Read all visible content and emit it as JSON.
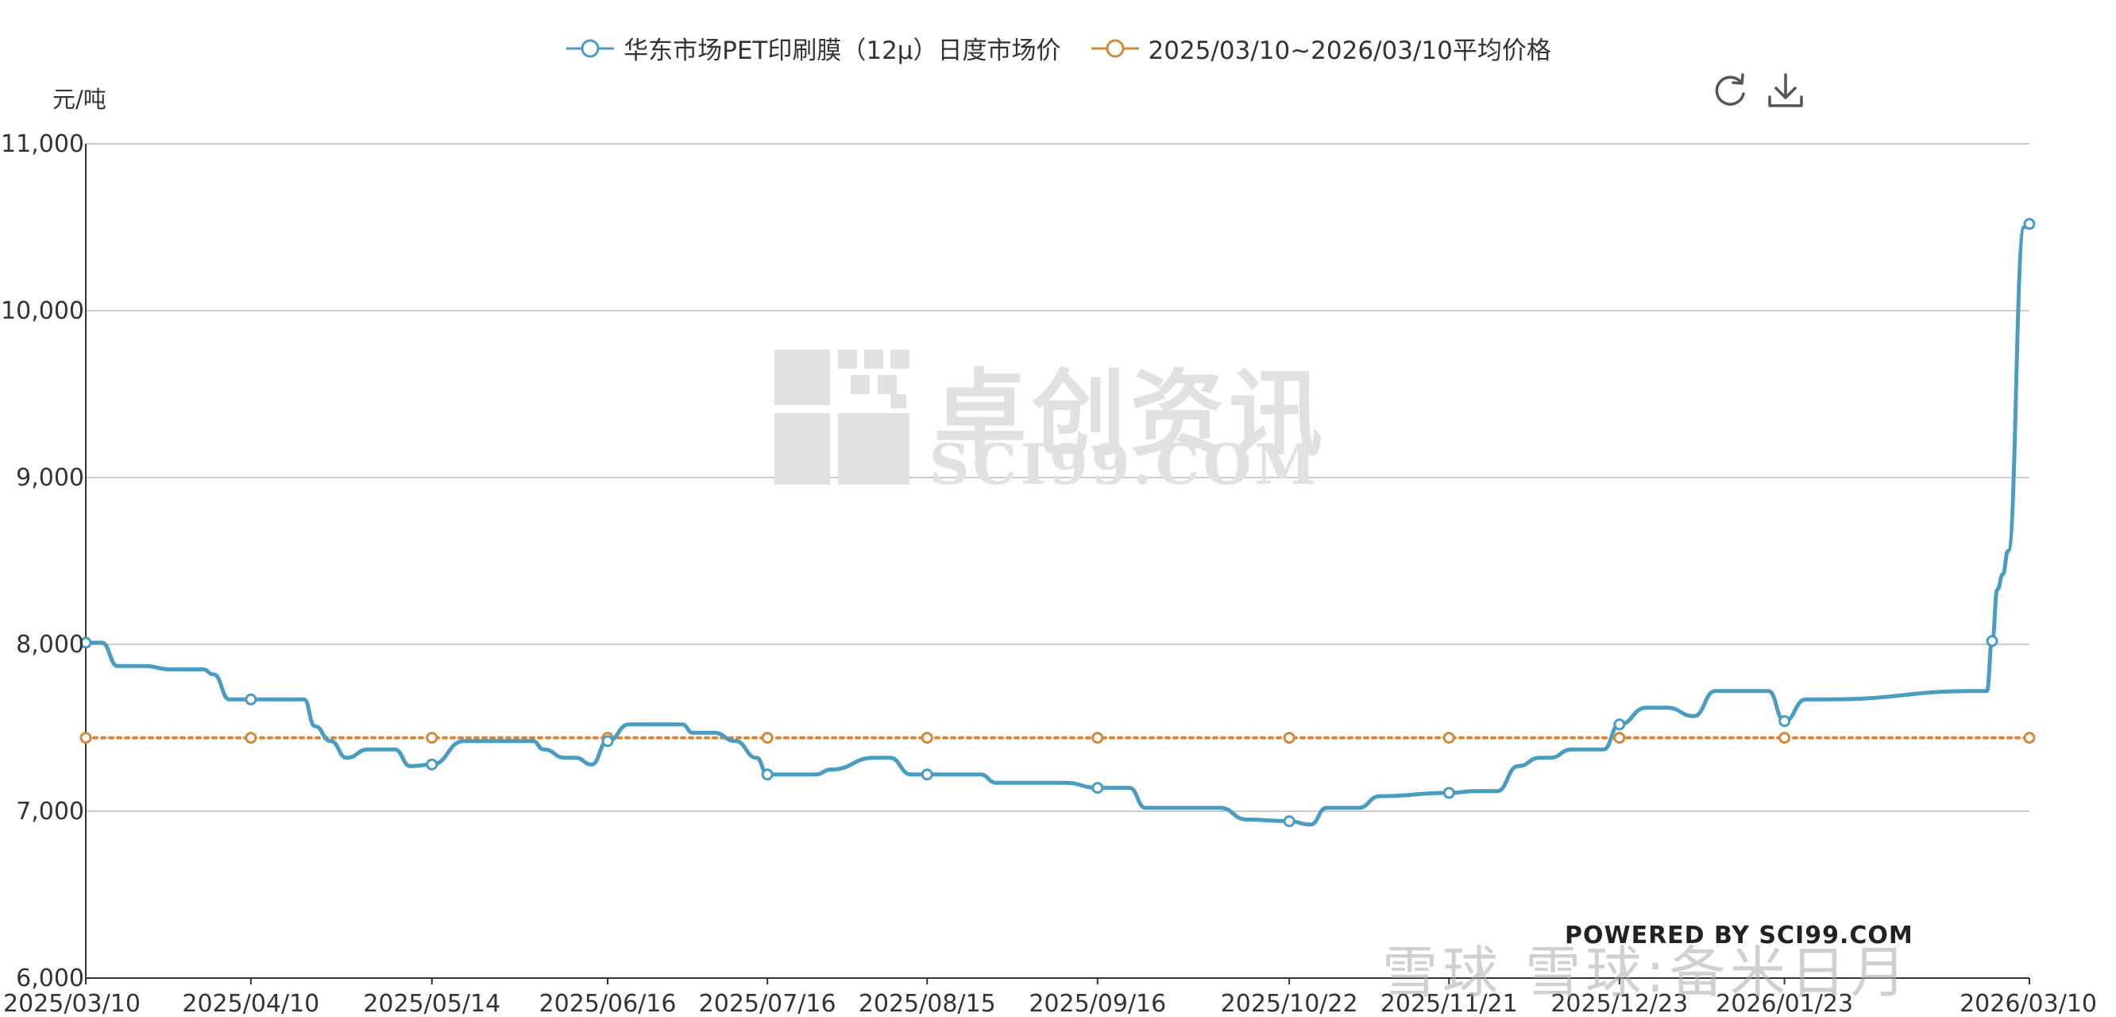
{
  "legend": {
    "series1_label": "华东市场PET印刷膜（12μ）日度市场价",
    "series2_label": "2025/03/10~2026/03/10平均价格"
  },
  "y_unit": "元/吨",
  "toolbar": {
    "refresh_icon": "refresh-icon",
    "download_icon": "download-icon"
  },
  "watermark": {
    "cn": "卓创资讯",
    "en": "SCI99.COM"
  },
  "powered_by": "POWERED BY SCI99.COM",
  "corner_watermark": "雪球 雪球:备米日月",
  "colors": {
    "series1": "#4a9cc0",
    "series2": "#d4893a",
    "grid": "#cccccc",
    "axis": "#333333"
  },
  "chart_data": {
    "type": "line",
    "ylim": [
      6000,
      11000
    ],
    "y_ticks": [
      "6,000",
      "7,000",
      "8,000",
      "9,000",
      "10,000",
      "11,000"
    ],
    "y_tick_values": [
      6000,
      7000,
      8000,
      9000,
      10000,
      11000
    ],
    "x_ticks": [
      "2025/03/10",
      "2025/04/10",
      "2025/05/14",
      "2025/06/16",
      "2025/07/16",
      "2025/08/15",
      "2025/09/16",
      "2025/10/22",
      "2025/11/21",
      "2025/12/23",
      "2026/01/23",
      "2026/03/10"
    ],
    "x_start": "2025/03/10",
    "x_end": "2026/03/10",
    "series": [
      {
        "name": "华东市场PET印刷膜（12μ）日度市场价",
        "x": [
          "2025/03/10",
          "2025/03/13",
          "2025/03/16",
          "2025/03/21",
          "2025/03/26",
          "2025/04/01",
          "2025/04/03",
          "2025/04/06",
          "2025/04/10",
          "2025/04/20",
          "2025/04/22",
          "2025/04/25",
          "2025/04/28",
          "2025/05/02",
          "2025/05/07",
          "2025/05/10",
          "2025/05/14",
          "2025/05/20",
          "2025/05/30",
          "2025/06/02",
          "2025/06/04",
          "2025/06/08",
          "2025/06/10",
          "2025/06/13",
          "2025/06/16",
          "2025/06/20",
          "2025/06/30",
          "2025/07/02",
          "2025/07/06",
          "2025/07/10",
          "2025/07/14",
          "2025/07/16",
          "2025/07/20",
          "2025/07/25",
          "2025/07/28",
          "2025/08/05",
          "2025/08/08",
          "2025/08/12",
          "2025/08/15",
          "2025/08/25",
          "2025/08/28",
          "2025/09/05",
          "2025/09/10",
          "2025/09/16",
          "2025/09/22",
          "2025/09/25",
          "2025/10/01",
          "2025/10/09",
          "2025/10/14",
          "2025/10/22",
          "2025/10/26",
          "2025/10/29",
          "2025/11/04",
          "2025/11/08",
          "2025/11/21",
          "2025/11/26",
          "2025/11/30",
          "2025/12/04",
          "2025/12/08",
          "2025/12/10",
          "2025/12/14",
          "2025/12/20",
          "2025/12/23",
          "2025/12/28",
          "2026/01/01",
          "2026/01/06",
          "2026/01/10",
          "2026/01/13",
          "2026/01/20",
          "2026/01/23",
          "2026/01/27",
          "2026/01/31",
          "2026/02/28",
          "2026/03/02",
          "2026/03/03",
          "2026/03/04",
          "2026/03/05",
          "2026/03/06",
          "2026/03/09",
          "2026/03/10"
        ],
        "values": [
          8010,
          8010,
          7870,
          7870,
          7850,
          7850,
          7820,
          7670,
          7670,
          7670,
          7510,
          7420,
          7320,
          7370,
          7370,
          7270,
          7280,
          7420,
          7420,
          7420,
          7370,
          7320,
          7320,
          7280,
          7420,
          7520,
          7520,
          7470,
          7470,
          7420,
          7320,
          7220,
          7220,
          7220,
          7250,
          7320,
          7320,
          7220,
          7220,
          7220,
          7170,
          7170,
          7170,
          7140,
          7140,
          7020,
          7020,
          7020,
          6950,
          6940,
          6920,
          7020,
          7020,
          7090,
          7110,
          7120,
          7120,
          7270,
          7320,
          7320,
          7370,
          7370,
          7520,
          7620,
          7620,
          7570,
          7720,
          7720,
          7720,
          7540,
          7670,
          7670,
          7720,
          7720,
          8020,
          8330,
          8420,
          8560,
          10500,
          10520
        ]
      },
      {
        "name": "2025/03/10~2026/03/10平均价格",
        "x": [
          "2025/03/10",
          "2026/03/10"
        ],
        "values": [
          7440,
          7440
        ]
      }
    ],
    "grid": true,
    "legend_position": "top-center"
  }
}
